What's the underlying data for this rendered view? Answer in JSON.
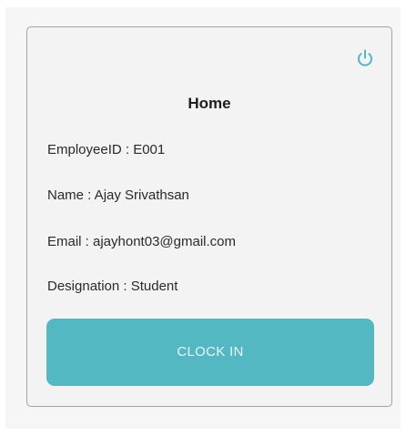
{
  "header": {
    "title": "Home"
  },
  "icons": {
    "logout": "power-icon"
  },
  "profile": {
    "employee_id": "EmployeeID : E001",
    "name": "Name : Ajay Srivathsan",
    "email": "Email : ajayhont03@gmail.com",
    "designation": "Designation : Student"
  },
  "actions": {
    "clock_in_label": "CLOCK IN"
  },
  "colors": {
    "accent": "#54b8c3",
    "background": "#f3f3f3",
    "border": "#a3a3a3"
  }
}
